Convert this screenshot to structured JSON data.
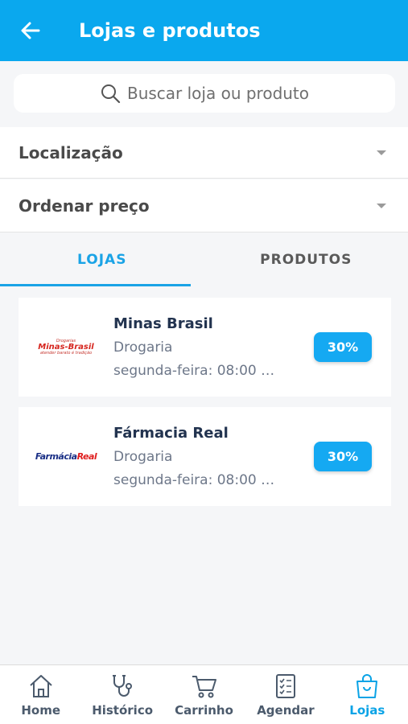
{
  "header": {
    "title": "Lojas e produtos",
    "back_icon": "arrow-left-icon"
  },
  "search": {
    "placeholder": "Buscar loja ou produto",
    "icon": "search-icon"
  },
  "filters": {
    "location_label": "Localização",
    "sort_label": "Ordenar preço"
  },
  "tabs": [
    {
      "label": "LOJAS",
      "active": true
    },
    {
      "label": "PRODUTOS",
      "active": false
    }
  ],
  "stores": [
    {
      "name": "Minas Brasil",
      "type": "Drogaria",
      "hours": "segunda-feira: 08:00 …",
      "discount": "30%",
      "logo": {
        "tagline": "Drogarias",
        "wordmark": "Minas-Brasil",
        "subtext": "atender barato é tradição"
      }
    },
    {
      "name": "Fármacia Real",
      "type": "Drogaria",
      "hours": "segunda-feira: 08:00 …",
      "discount": "30%",
      "logo": {
        "wordmark_a": "Farmácia",
        "wordmark_b": "Real"
      }
    }
  ],
  "nav": [
    {
      "label": "Home",
      "icon": "home-icon",
      "active": false
    },
    {
      "label": "Histórico",
      "icon": "stethoscope-icon",
      "active": false
    },
    {
      "label": "Carrinho",
      "icon": "cart-icon",
      "active": false
    },
    {
      "label": "Agendar",
      "icon": "checklist-icon",
      "active": false
    },
    {
      "label": "Lojas",
      "icon": "shopping-bag-icon",
      "active": true
    }
  ],
  "colors": {
    "primary": "#0aa8ee",
    "badge": "#15a9f2",
    "text_dark": "#22334f"
  }
}
